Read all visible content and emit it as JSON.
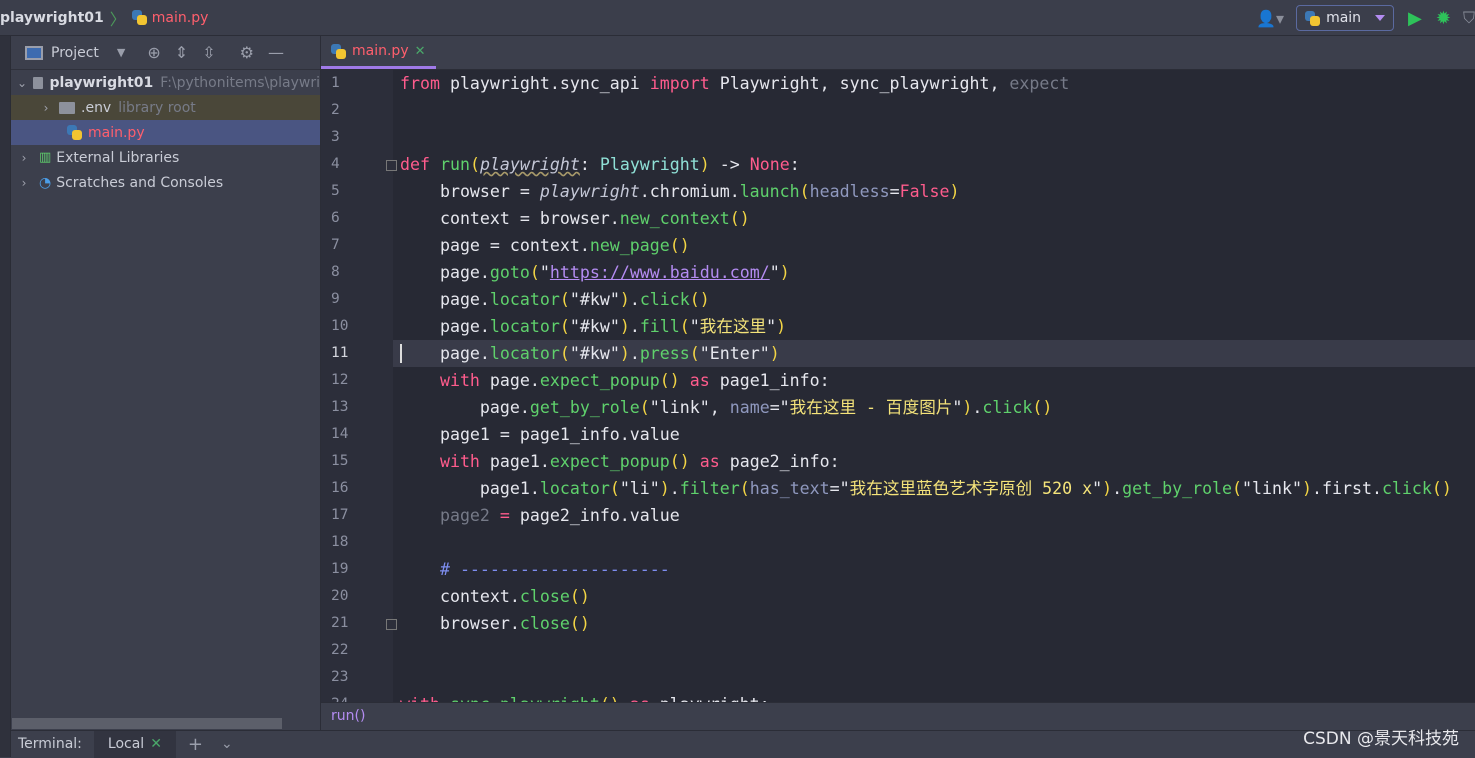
{
  "breadcrumb": {
    "project": "playwright01",
    "file": "main.py"
  },
  "toolbar": {
    "run_config": "main"
  },
  "project_panel": {
    "title": "Project",
    "tree": [
      {
        "label": "playwright01",
        "note": "F:\\pythonitems\\playwri",
        "expanded": true
      },
      {
        "label": ".env",
        "note": "library root"
      },
      {
        "label": "main.py"
      },
      {
        "label": "External Libraries"
      },
      {
        "label": "Scratches and Consoles"
      }
    ]
  },
  "editor": {
    "tab": "main.py",
    "current_line": 11,
    "breadcrumb": "run()",
    "lines": [
      [
        [
          "kw",
          "from "
        ],
        [
          "",
          "playwright.sync_api "
        ],
        [
          "kw",
          "import "
        ],
        [
          "",
          "Playwright, sync_playwright, "
        ],
        [
          "dm",
          "expect"
        ]
      ],
      [],
      [],
      [
        [
          "kw",
          "def "
        ],
        [
          "fn",
          "run"
        ],
        [
          "pn",
          "("
        ],
        [
          "itu",
          "playwright"
        ],
        [
          "",
          ": "
        ],
        [
          "cls",
          "Playwright"
        ],
        [
          "pn",
          ")"
        ],
        [
          "",
          " -> "
        ],
        [
          "kw",
          "None"
        ],
        [
          "",
          ":"
        ]
      ],
      [
        [
          "",
          "    browser = "
        ],
        [
          "it",
          "playwright"
        ],
        [
          "",
          ".chromium."
        ],
        [
          "fn",
          "launch"
        ],
        [
          "pn",
          "("
        ],
        [
          "par",
          "headless"
        ],
        [
          "",
          "="
        ],
        [
          "kw",
          "False"
        ],
        [
          "pn",
          ")"
        ]
      ],
      [
        [
          "",
          "    context = browser."
        ],
        [
          "fn",
          "new_context"
        ],
        [
          "pn",
          "()"
        ]
      ],
      [
        [
          "",
          "    page = context."
        ],
        [
          "fn",
          "new_page"
        ],
        [
          "pn",
          "()"
        ]
      ],
      [
        [
          "",
          "    page."
        ],
        [
          "fn",
          "goto"
        ],
        [
          "pn",
          "("
        ],
        [
          "",
          "\""
        ],
        [
          "url",
          "https://www.baidu.com/"
        ],
        [
          "",
          "\""
        ],
        [
          "pn",
          ")"
        ]
      ],
      [
        [
          "",
          "    page."
        ],
        [
          "fn",
          "locator"
        ],
        [
          "pn",
          "("
        ],
        [
          "",
          "\"#kw\""
        ],
        [
          "pn",
          ")"
        ],
        [
          "",
          "."
        ],
        [
          "fn",
          "click"
        ],
        [
          "pn",
          "()"
        ]
      ],
      [
        [
          "",
          "    page."
        ],
        [
          "fn",
          "locator"
        ],
        [
          "pn",
          "("
        ],
        [
          "",
          "\"#kw\""
        ],
        [
          "pn",
          ")"
        ],
        [
          "",
          "."
        ],
        [
          "fn",
          "fill"
        ],
        [
          "pn",
          "("
        ],
        [
          "",
          "\""
        ],
        [
          "cn",
          "我在这里"
        ],
        [
          "",
          "\""
        ],
        [
          "pn",
          ")"
        ]
      ],
      [
        [
          "",
          "    page."
        ],
        [
          "fn",
          "locator"
        ],
        [
          "pn",
          "("
        ],
        [
          "",
          "\"#kw\""
        ],
        [
          "pn",
          ")"
        ],
        [
          "",
          "."
        ],
        [
          "fn",
          "press"
        ],
        [
          "pn",
          "("
        ],
        [
          "",
          "\"Enter\""
        ],
        [
          "pn",
          ")"
        ]
      ],
      [
        [
          "kw",
          "    with "
        ],
        [
          "",
          "page."
        ],
        [
          "fn",
          "expect_popup"
        ],
        [
          "pn",
          "()"
        ],
        [
          "kw",
          " as "
        ],
        [
          "",
          "page1_info:"
        ]
      ],
      [
        [
          "",
          "        page."
        ],
        [
          "fn",
          "get_by_role"
        ],
        [
          "pn",
          "("
        ],
        [
          "",
          "\"link\", "
        ],
        [
          "par",
          "name"
        ],
        [
          "",
          "=\""
        ],
        [
          "cn",
          "我在这里 - 百度图片"
        ],
        [
          "",
          "\""
        ],
        [
          "pn",
          ")"
        ],
        [
          "",
          "."
        ],
        [
          "fn",
          "click"
        ],
        [
          "pn",
          "()"
        ]
      ],
      [
        [
          "",
          "    page1 = page1_info.value"
        ]
      ],
      [
        [
          "kw",
          "    with "
        ],
        [
          "",
          "page1."
        ],
        [
          "fn",
          "expect_popup"
        ],
        [
          "pn",
          "()"
        ],
        [
          "kw",
          " as "
        ],
        [
          "",
          "page2_info:"
        ]
      ],
      [
        [
          "",
          "        page1."
        ],
        [
          "fn",
          "locator"
        ],
        [
          "pn",
          "("
        ],
        [
          "",
          "\"li\""
        ],
        [
          "pn",
          ")"
        ],
        [
          "",
          "."
        ],
        [
          "fn",
          "filter"
        ],
        [
          "pn",
          "("
        ],
        [
          "par",
          "has_text"
        ],
        [
          "",
          "=\""
        ],
        [
          "cn",
          "我在这里蓝色艺术字原创 520 x"
        ],
        [
          "",
          "\""
        ],
        [
          "pn",
          ")"
        ],
        [
          "",
          "."
        ],
        [
          "fn",
          "get_by_role"
        ],
        [
          "pn",
          "("
        ],
        [
          "",
          "\"link\""
        ],
        [
          "pn",
          ")"
        ],
        [
          "",
          ".first."
        ],
        [
          "fn",
          "click"
        ],
        [
          "pn",
          "()"
        ]
      ],
      [
        [
          "dm",
          "    page2"
        ],
        [
          "kw",
          " = "
        ],
        [
          "",
          "page2_info.value"
        ]
      ],
      [],
      [
        [
          "cm",
          "    # ---------------------"
        ]
      ],
      [
        [
          "",
          "    context."
        ],
        [
          "fn",
          "close"
        ],
        [
          "pn",
          "()"
        ]
      ],
      [
        [
          "",
          "    browser."
        ],
        [
          "fn",
          "close"
        ],
        [
          "pn",
          "()"
        ]
      ],
      [],
      [],
      [
        [
          "kw",
          "with "
        ],
        [
          "fn",
          "sync_playwright"
        ],
        [
          "pn",
          "()"
        ],
        [
          "kw",
          " as "
        ],
        [
          "",
          "playwright:"
        ]
      ]
    ]
  },
  "terminal": {
    "label": "Terminal:",
    "tab": "Local"
  },
  "watermark": "CSDN @景天科技苑"
}
